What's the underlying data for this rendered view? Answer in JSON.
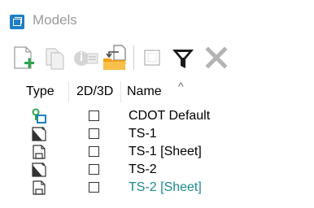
{
  "window": {
    "title": "Models"
  },
  "toolbar": {
    "buttons": [
      {
        "icon": "new-model-icon",
        "enabled": true
      },
      {
        "icon": "copy-model-icon",
        "enabled": false
      },
      {
        "icon": "properties-icon",
        "enabled": false
      },
      {
        "icon": "import-model-icon",
        "enabled": true
      },
      {
        "icon": "select-all-icon",
        "enabled": false
      },
      {
        "icon": "filter-icon",
        "enabled": true
      },
      {
        "icon": "delete-icon",
        "enabled": false
      }
    ]
  },
  "columns": {
    "type": "Type",
    "dim": "2D/3D",
    "name": "Name",
    "sort_indicator": "^"
  },
  "models": [
    {
      "icon": "design-model-icon",
      "checked": false,
      "name": "CDOT Default",
      "active": false
    },
    {
      "icon": "drawing-model-icon",
      "checked": false,
      "name": "TS-1",
      "active": false
    },
    {
      "icon": "sheet-model-icon",
      "checked": false,
      "name": "TS-1 [Sheet]",
      "active": false
    },
    {
      "icon": "drawing-model-icon",
      "checked": false,
      "name": "TS-2",
      "active": false
    },
    {
      "icon": "sheet-model-icon",
      "checked": false,
      "name": "TS-2 [Sheet]",
      "active": true
    }
  ],
  "colors": {
    "accent": "#1e7fc6",
    "active_row_text": "#1b8a8f",
    "title_text": "#9a9a9a",
    "green_icon": "#2da44e"
  }
}
